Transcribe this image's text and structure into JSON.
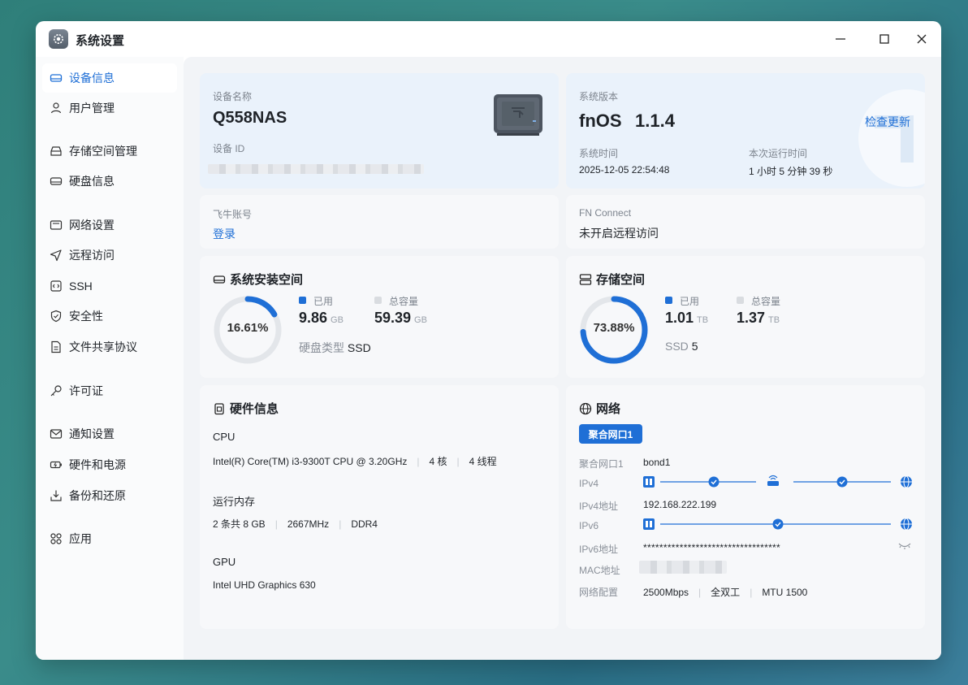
{
  "window": {
    "title": "系统设置"
  },
  "sidebar": {
    "items": [
      {
        "label": "设备信息",
        "icon": "hdd-icon",
        "active": true
      },
      {
        "label": "用户管理",
        "icon": "user-icon"
      },
      {
        "label": "存储空间管理",
        "icon": "storage-icon"
      },
      {
        "label": "硬盘信息",
        "icon": "disk-icon"
      },
      {
        "label": "网络设置",
        "icon": "network-icon"
      },
      {
        "label": "远程访问",
        "icon": "send-icon"
      },
      {
        "label": "SSH",
        "icon": "terminal-icon"
      },
      {
        "label": "安全性",
        "icon": "shield-icon"
      },
      {
        "label": "文件共享协议",
        "icon": "file-icon"
      },
      {
        "label": "许可证",
        "icon": "key-icon"
      },
      {
        "label": "通知设置",
        "icon": "mail-icon"
      },
      {
        "label": "硬件和电源",
        "icon": "battery-icon"
      },
      {
        "label": "备份和还原",
        "icon": "download-icon"
      },
      {
        "label": "应用",
        "icon": "apps-icon"
      }
    ]
  },
  "device": {
    "name_label": "设备名称",
    "name": "Q558NAS",
    "id_label": "设备 ID"
  },
  "system": {
    "version_label": "系统版本",
    "version_name": "fnOS",
    "version": "1.1.4",
    "check_update": "检查更新",
    "time_label": "系统时间",
    "time": "2025-12-05 22:54:48",
    "uptime_label": "本次运行时间",
    "uptime": "1 小时 5 分钟 39 秒"
  },
  "account": {
    "label": "飞牛账号",
    "login": "登录"
  },
  "fnconnect": {
    "label": "FN Connect",
    "status": "未开启远程访问"
  },
  "system_storage": {
    "title": "系统安装空间",
    "percent": "16.61%",
    "fraction": 0.1661,
    "used_label": "已用",
    "used": "9.86",
    "used_unit": "GB",
    "total_label": "总容量",
    "total": "59.39",
    "total_unit": "GB",
    "disk_type_label": "硬盘类型",
    "disk_type": "SSD"
  },
  "storage": {
    "title": "存储空间",
    "percent": "73.88%",
    "fraction": 0.7388,
    "used_label": "已用",
    "used": "1.01",
    "used_unit": "TB",
    "total_label": "总容量",
    "total": "1.37",
    "total_unit": "TB",
    "disk_label": "SSD",
    "disk_count": "5"
  },
  "hardware": {
    "title": "硬件信息",
    "cpu_label": "CPU",
    "cpu_model": "Intel(R) Core(TM) i3-9300T CPU @ 3.20GHz",
    "cpu_cores": "4 核",
    "cpu_threads": "4 线程",
    "ram_label": "运行内存",
    "ram_sticks": "2 条共 8 GB",
    "ram_speed": "2667MHz",
    "ram_type": "DDR4",
    "gpu_label": "GPU",
    "gpu_model": "Intel UHD Graphics 630"
  },
  "network": {
    "title": "网络",
    "tab": "聚合网口1",
    "iface_label": "聚合网口1",
    "iface": "bond1",
    "ipv4_label": "IPv4",
    "ipv4_addr_label": "IPv4地址",
    "ipv4_addr": "192.168.222.199",
    "ipv6_label": "IPv6",
    "ipv6_addr_label": "IPv6地址",
    "ipv6_addr": "**********************************",
    "mac_label": "MAC地址",
    "config_label": "网络配置",
    "speed": "2500Mbps",
    "duplex": "全双工",
    "mtu": "MTU 1500"
  },
  "colors": {
    "accent": "#1f6fd6",
    "ring_track": "#e3e6ea"
  }
}
